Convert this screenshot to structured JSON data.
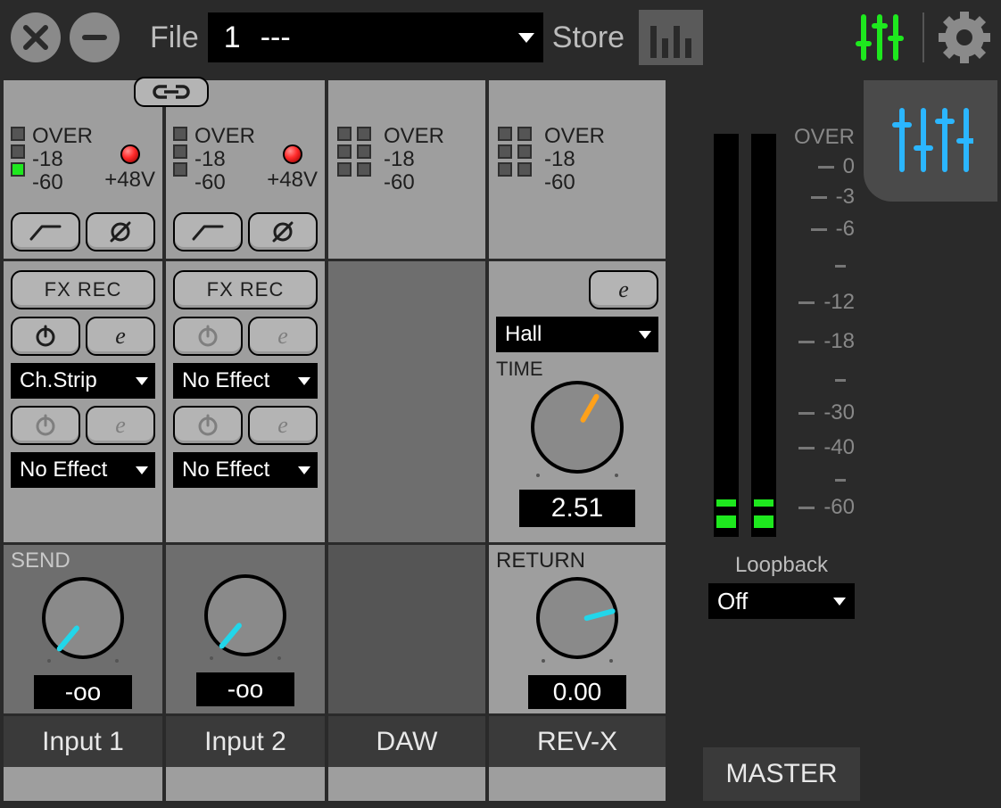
{
  "toolbar": {
    "file_label": "File",
    "preset_number": "1",
    "preset_name": "---",
    "store_label": "Store"
  },
  "meter": {
    "over": "OVER",
    "m18": "-18",
    "m60": "-60"
  },
  "phantom_label": "+48V",
  "fx": {
    "fxrec": "FX REC",
    "ch1_slot1": "Ch.Strip",
    "ch1_slot2": "No Effect",
    "ch2_slot1": "No Effect",
    "ch2_slot2": "No Effect"
  },
  "revx": {
    "type": "Hall",
    "time_label": "TIME",
    "time_value": "2.51"
  },
  "send": {
    "label": "SEND",
    "return_label": "RETURN",
    "ch1_value": "-oo",
    "ch2_value": "-oo",
    "return_value": "0.00"
  },
  "names": {
    "ch1": "Input 1",
    "ch2": "Input 2",
    "ch3": "DAW",
    "ch4": "REV-X",
    "master": "MASTER"
  },
  "master": {
    "scale": [
      "0",
      "-3",
      "-6",
      "",
      "-12",
      "-18",
      "",
      "-30",
      "-40",
      "",
      "-60"
    ],
    "over": "OVER",
    "loopback_label": "Loopback",
    "loopback_value": "Off"
  }
}
